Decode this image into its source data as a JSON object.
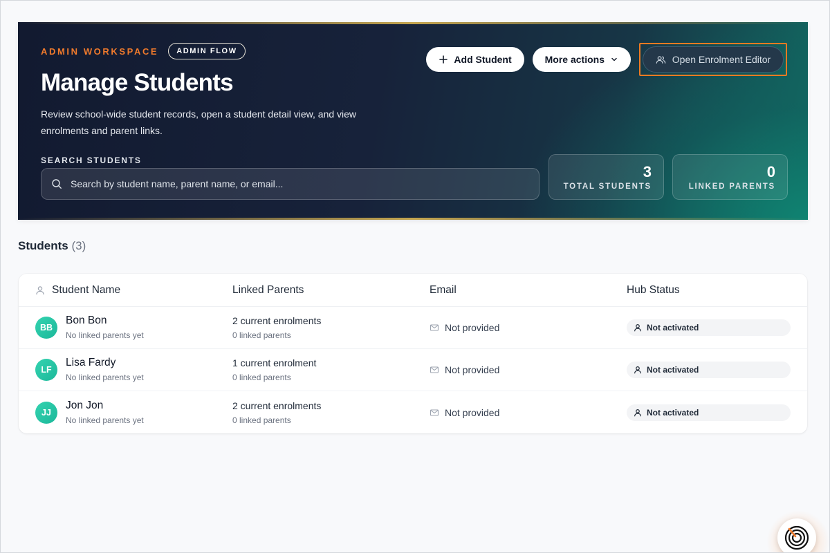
{
  "hero": {
    "eyebrow": "ADMIN WORKSPACE",
    "badge": "ADMIN FLOW",
    "title": "Manage Students",
    "description": "Review school-wide student records, open a student detail view, and view enrolments and parent links.",
    "actions": {
      "add_student": "Add Student",
      "more_actions": "More actions",
      "open_editor": "Open Enrolment Editor"
    },
    "search": {
      "label": "SEARCH STUDENTS",
      "placeholder": "Search by student name, parent name, or email..."
    },
    "stats": [
      {
        "value": "3",
        "label": "TOTAL STUDENTS"
      },
      {
        "value": "0",
        "label": "LINKED PARENTS"
      }
    ]
  },
  "section": {
    "title": "Students",
    "count": "(3)"
  },
  "table": {
    "headers": [
      "Student Name",
      "Linked Parents",
      "Email",
      "Hub Status"
    ],
    "rows": [
      {
        "initials": "BB",
        "name": "Bon Bon",
        "sub": "No linked parents yet",
        "enrolments": "2 current enrolments",
        "parents": "0 linked parents",
        "email": "Not provided",
        "status": "Not activated"
      },
      {
        "initials": "LF",
        "name": "Lisa Fardy",
        "sub": "No linked parents yet",
        "enrolments": "1 current enrolment",
        "parents": "0 linked parents",
        "email": "Not provided",
        "status": "Not activated"
      },
      {
        "initials": "JJ",
        "name": "Jon Jon",
        "sub": "No linked parents yet",
        "enrolments": "2 current enrolments",
        "parents": "0 linked parents",
        "email": "Not provided",
        "status": "Not activated"
      }
    ]
  },
  "colors": {
    "accent_orange": "#f07a2c",
    "avatar_teal": "#22c3a2",
    "hero_dark": "#121a30",
    "hero_teal": "#126a62"
  },
  "icons": [
    "plus-icon",
    "chevron-down-icon",
    "users-icon",
    "search-icon",
    "user-icon",
    "mail-icon",
    "widget-logo-icon"
  ]
}
